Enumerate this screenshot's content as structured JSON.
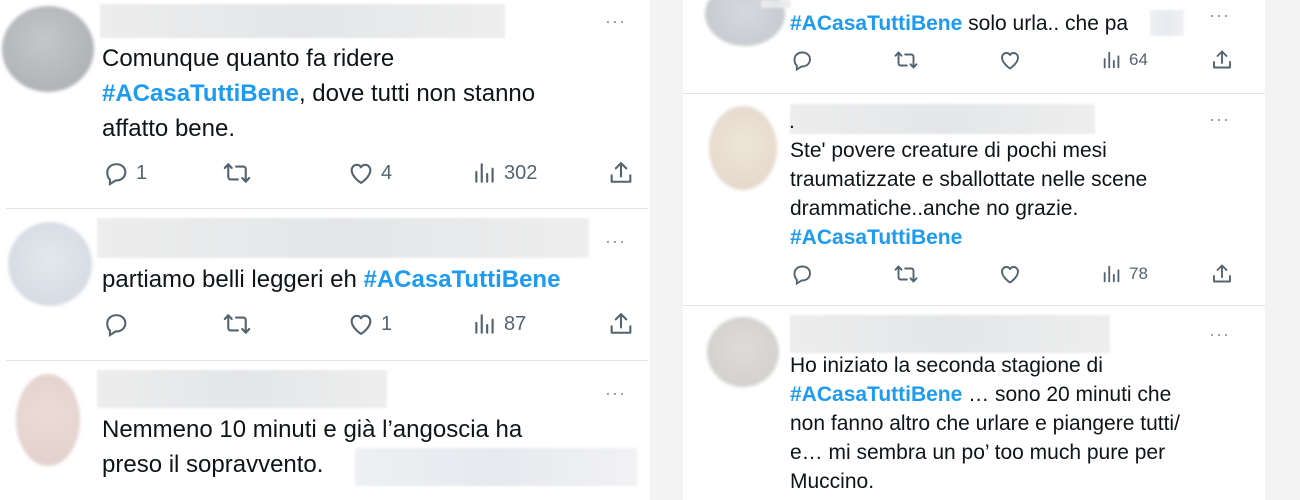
{
  "left": {
    "tweets": [
      {
        "text_before": "Comunque quanto fa ridere\n",
        "hashtag": "#ACasaTuttiBene",
        "text_after": ", dove tutti non stanno\naffatto bene.",
        "replies": "1",
        "retweets": "",
        "likes": "4",
        "views": "302"
      },
      {
        "text_before": "partiamo belli leggeri eh ",
        "hashtag": "#ACasaTuttiBene",
        "text_after": "",
        "replies": "",
        "retweets": "",
        "likes": "1",
        "views": "87"
      },
      {
        "text_before": "Nemmeno 10 minuti e già l’angoscia ha\npreso il sopravvento.",
        "hashtag": "",
        "text_after": ""
      }
    ]
  },
  "right": {
    "tweets": [
      {
        "hashtag": "#ACasaTuttiBene",
        "text_after": " solo urla.. che pa",
        "replies": "",
        "retweets": "",
        "likes": "",
        "views": "64"
      },
      {
        "handle_dot": ".",
        "text_before": "Ste' povere creature di pochi mesi\ntraumatizzate e sballottate nelle scene\ndrammatiche..anche no grazie.\n ",
        "hashtag": "#ACasaTuttiBene",
        "replies": "",
        "retweets": "",
        "likes": "",
        "views": "78"
      },
      {
        "text_before": "Ho iniziato la seconda stagione di\n",
        "hashtag": "#ACasaTuttiBene",
        "text_after": " … sono 20 minuti che\nnon fanno altro  che urlare e piangere tutti/\ne… mi sembra un po’ too much pure per\nMuccino."
      }
    ]
  },
  "ui": {
    "more_label": "···"
  },
  "colors": {
    "hashtag": "#1d9bf0",
    "icon": "#536471",
    "separator": "#e3e6e8"
  },
  "icons": [
    "reply-icon",
    "retweet-icon",
    "like-icon",
    "views-icon",
    "share-icon",
    "more-icon"
  ]
}
